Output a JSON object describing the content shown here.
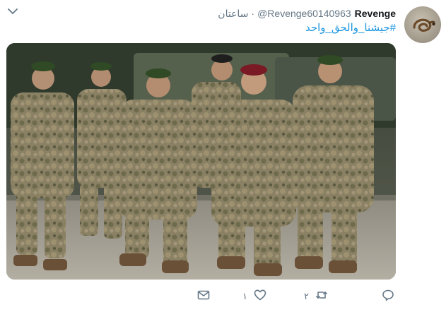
{
  "tweet": {
    "display_name": "Revenge",
    "handle": "@Revenge60140963",
    "separator": "·",
    "time": "ساعتان",
    "hashtag": "#جيشنا_والحق_واحد",
    "avatar_icon": "coiled-snake-avatar",
    "media_icon": "soldiers-photo",
    "menu_icon": "chevron-down-icon"
  },
  "actions": {
    "reply_icon": "reply-icon",
    "retweet_icon": "retweet-icon",
    "retweet_count": "٢",
    "like_icon": "heart-icon",
    "like_count": "١",
    "dm_icon": "envelope-icon"
  },
  "colors": {
    "link": "#1b95e0",
    "secondary_text": "#657786",
    "icon": "#657786"
  }
}
